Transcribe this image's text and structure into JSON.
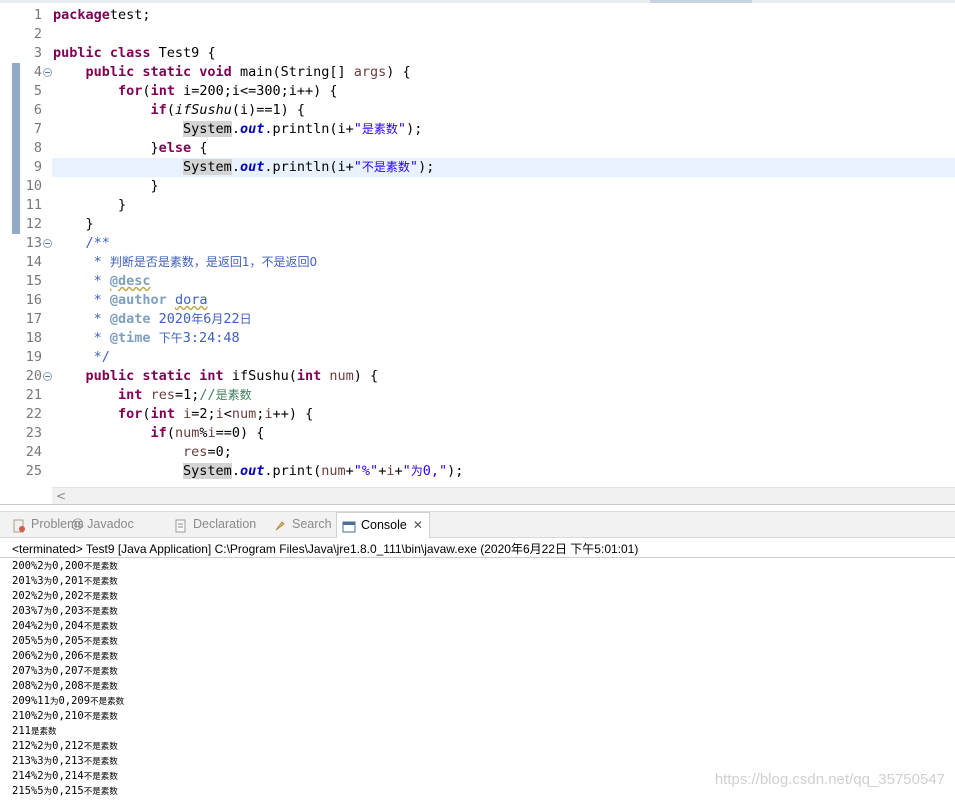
{
  "editor": {
    "lines": [
      {
        "n": "1",
        "segs": [
          [
            "kw",
            "package"
          ],
          [
            "",
            "test;"
          ]
        ]
      },
      {
        "n": "2",
        "segs": []
      },
      {
        "n": "3",
        "segs": [
          [
            "kw",
            "public class"
          ],
          [
            "",
            " Test9 {"
          ]
        ]
      },
      {
        "n": "4",
        "fold": true,
        "segs": [
          [
            "",
            "    "
          ],
          [
            "kw",
            "public static void"
          ],
          [
            "",
            " main(String[] "
          ],
          [
            "var",
            "args"
          ],
          [
            "",
            ") {"
          ]
        ]
      },
      {
        "n": "5",
        "segs": [
          [
            "",
            "        "
          ],
          [
            "kw",
            "for"
          ],
          [
            "",
            "("
          ],
          [
            "kw",
            "int"
          ],
          [
            "",
            " i=200;i<=300;i++) {"
          ]
        ]
      },
      {
        "n": "6",
        "segs": [
          [
            "",
            "            "
          ],
          [
            "kw",
            "if"
          ],
          [
            "",
            "("
          ],
          [
            "ital",
            "ifSushu"
          ],
          [
            "",
            "(i)==1) {"
          ]
        ]
      },
      {
        "n": "7",
        "segs": [
          [
            "",
            "                "
          ],
          [
            "sys",
            "System"
          ],
          [
            "",
            "."
          ],
          [
            "fld",
            "out"
          ],
          [
            "",
            ".println(i+"
          ],
          [
            "str",
            "\""
          ],
          [
            "str cjk",
            "是素数"
          ],
          [
            "str",
            "\""
          ],
          [
            "",
            ");"
          ]
        ]
      },
      {
        "n": "8",
        "segs": [
          [
            "",
            "            }"
          ],
          [
            "kw",
            "else"
          ],
          [
            "",
            " {"
          ]
        ]
      },
      {
        "n": "9",
        "hl": true,
        "segs": [
          [
            "",
            "                "
          ],
          [
            "sys",
            "System"
          ],
          [
            "",
            "."
          ],
          [
            "fld",
            "out"
          ],
          [
            "",
            ".println(i+"
          ],
          [
            "str",
            "\""
          ],
          [
            "str cjk",
            "不是素数"
          ],
          [
            "str",
            "\""
          ],
          [
            "",
            ");"
          ]
        ]
      },
      {
        "n": "10",
        "segs": [
          [
            "",
            "            }"
          ]
        ]
      },
      {
        "n": "11",
        "segs": [
          [
            "",
            "        }"
          ]
        ]
      },
      {
        "n": "12",
        "segs": [
          [
            "",
            "    }"
          ]
        ]
      },
      {
        "n": "13",
        "fold": true,
        "segs": [
          [
            "",
            "    "
          ],
          [
            "jd",
            "/**"
          ]
        ]
      },
      {
        "n": "14",
        "segs": [
          [
            "",
            "     "
          ],
          [
            "jd",
            "* "
          ],
          [
            "jd cjk",
            "判断是否是素数，是返回1，不是返回0"
          ]
        ]
      },
      {
        "n": "15",
        "segs": [
          [
            "",
            "     "
          ],
          [
            "jd",
            "* "
          ],
          [
            "tag sq",
            "@desc"
          ]
        ]
      },
      {
        "n": "16",
        "segs": [
          [
            "",
            "     "
          ],
          [
            "jd",
            "* "
          ],
          [
            "tag",
            "@author"
          ],
          [
            "jd",
            " "
          ],
          [
            "jd sq",
            "dora"
          ]
        ]
      },
      {
        "n": "17",
        "segs": [
          [
            "",
            "     "
          ],
          [
            "jd",
            "* "
          ],
          [
            "tag",
            "@date"
          ],
          [
            "jd",
            " 2020"
          ],
          [
            "jd cjk",
            "年"
          ],
          [
            "jd",
            "6"
          ],
          [
            "jd cjk",
            "月"
          ],
          [
            "jd",
            "22"
          ],
          [
            "jd cjk",
            "日"
          ]
        ]
      },
      {
        "n": "18",
        "segs": [
          [
            "",
            "     "
          ],
          [
            "jd",
            "* "
          ],
          [
            "tag",
            "@time"
          ],
          [
            "jd",
            " "
          ],
          [
            "jd cjk",
            "下午"
          ],
          [
            "jd",
            "3:24:48"
          ]
        ]
      },
      {
        "n": "19",
        "segs": [
          [
            "",
            "     "
          ],
          [
            "jd",
            "*/"
          ]
        ]
      },
      {
        "n": "20",
        "fold": true,
        "segs": [
          [
            "",
            "    "
          ],
          [
            "kw",
            "public static int"
          ],
          [
            "",
            " ifSushu("
          ],
          [
            "kw",
            "int"
          ],
          [
            "",
            ""
          ],
          [
            "var",
            " num"
          ],
          [
            "",
            ") {"
          ]
        ]
      },
      {
        "n": "21",
        "segs": [
          [
            "",
            "        "
          ],
          [
            "kw",
            "int"
          ],
          [
            "",
            " "
          ],
          [
            "var",
            "res"
          ],
          [
            "",
            "=1;"
          ],
          [
            "cm",
            "//"
          ],
          [
            "cm cjk",
            "是素数"
          ]
        ]
      },
      {
        "n": "22",
        "segs": [
          [
            "",
            "        "
          ],
          [
            "kw",
            "for"
          ],
          [
            "",
            "("
          ],
          [
            "kw",
            "int"
          ],
          [
            "",
            " "
          ],
          [
            "var",
            "i"
          ],
          [
            "",
            "=2;"
          ],
          [
            "var",
            "i"
          ],
          [
            "",
            "<"
          ],
          [
            "var",
            "num"
          ],
          [
            "",
            ";"
          ],
          [
            "var",
            "i"
          ],
          [
            "",
            "++) {"
          ]
        ]
      },
      {
        "n": "23",
        "segs": [
          [
            "",
            "            "
          ],
          [
            "kw",
            "if"
          ],
          [
            "",
            "("
          ],
          [
            "var",
            "num"
          ],
          [
            "",
            "%"
          ],
          [
            "var",
            "i"
          ],
          [
            "",
            "==0) {"
          ]
        ]
      },
      {
        "n": "24",
        "segs": [
          [
            "",
            "                "
          ],
          [
            "var",
            "res"
          ],
          [
            "",
            "=0;"
          ]
        ]
      },
      {
        "n": "25",
        "segs": [
          [
            "",
            "                "
          ],
          [
            "sys",
            "System"
          ],
          [
            "",
            "."
          ],
          [
            "fld",
            "out"
          ],
          [
            "",
            ".print("
          ],
          [
            "var",
            "num"
          ],
          [
            "",
            "+"
          ],
          [
            "str",
            "\"%\""
          ],
          [
            "",
            "+"
          ],
          [
            "var",
            "i"
          ],
          [
            "",
            "+"
          ],
          [
            "str",
            "\""
          ],
          [
            "str cjk",
            "为"
          ],
          [
            "str",
            "0,\""
          ],
          [
            "",
            ");"
          ]
        ]
      }
    ],
    "scroll_arrow": "<"
  },
  "panel": {
    "tabs": [
      {
        "label": "Problems",
        "icon": "problems-icon",
        "active": false
      },
      {
        "label": "@ Javadoc",
        "icon": "",
        "active": false
      },
      {
        "label": "Declaration",
        "icon": "declaration-icon",
        "active": false
      },
      {
        "label": "Search",
        "icon": "search-icon",
        "active": false
      },
      {
        "label": "Console",
        "icon": "console-icon",
        "active": true
      }
    ],
    "close_glyph": "✕",
    "status": "<terminated> Test9 [Java Application] C:\\Program Files\\Java\\jre1.8.0_111\\bin\\javaw.exe (2020年6月22日 下午5:01:01)",
    "output": [
      {
        "a": "200%2",
        "b": "为",
        "c": "0,200",
        "d": "不是素数"
      },
      {
        "a": "201%3",
        "b": "为",
        "c": "0,201",
        "d": "不是素数"
      },
      {
        "a": "202%2",
        "b": "为",
        "c": "0,202",
        "d": "不是素数"
      },
      {
        "a": "203%7",
        "b": "为",
        "c": "0,203",
        "d": "不是素数"
      },
      {
        "a": "204%2",
        "b": "为",
        "c": "0,204",
        "d": "不是素数"
      },
      {
        "a": "205%5",
        "b": "为",
        "c": "0,205",
        "d": "不是素数"
      },
      {
        "a": "206%2",
        "b": "为",
        "c": "0,206",
        "d": "不是素数"
      },
      {
        "a": "207%3",
        "b": "为",
        "c": "0,207",
        "d": "不是素数"
      },
      {
        "a": "208%2",
        "b": "为",
        "c": "0,208",
        "d": "不是素数"
      },
      {
        "a": "209%11",
        "b": "为",
        "c": "0,209",
        "d": "不是素数"
      },
      {
        "a": "210%2",
        "b": "为",
        "c": "0,210",
        "d": "不是素数"
      },
      {
        "a": "211",
        "b": "",
        "c": "",
        "d": "是素数"
      },
      {
        "a": "212%2",
        "b": "为",
        "c": "0,212",
        "d": "不是素数"
      },
      {
        "a": "213%3",
        "b": "为",
        "c": "0,213",
        "d": "不是素数"
      },
      {
        "a": "214%2",
        "b": "为",
        "c": "0,214",
        "d": "不是素数"
      },
      {
        "a": "215%5",
        "b": "为",
        "c": "0,215",
        "d": "不是素数"
      }
    ],
    "watermark": "https://blog.csdn.net/qq_35750547"
  },
  "colors": {
    "keyword": "#7f0055",
    "string": "#2a00ff",
    "comment": "#3f7f5f",
    "javadoc": "#3f5fbf",
    "highlight": "#e8f2fe"
  }
}
